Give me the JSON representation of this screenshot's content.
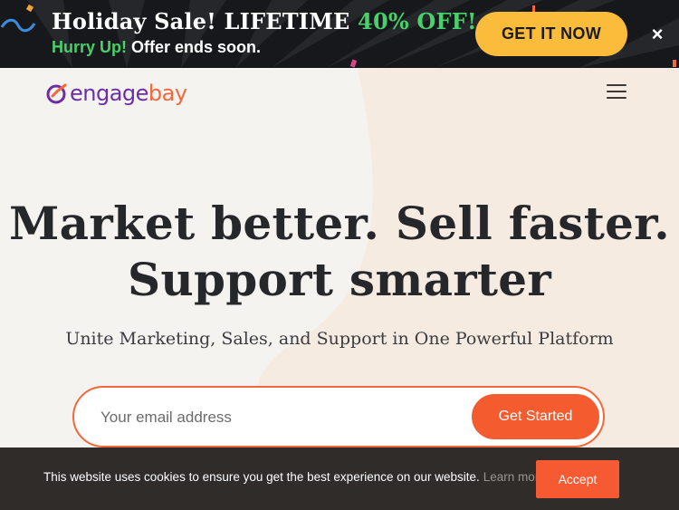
{
  "promo": {
    "title_prefix": "Holiday Sale! LIFETIME ",
    "title_highlight": "40% OFF!",
    "sub_highlight": "Hurry Up!",
    "sub_rest": " Offer ends soon.",
    "cta_label": "GET IT NOW",
    "close_label": "×"
  },
  "header": {
    "logo_part1": "engage",
    "logo_part2": "bay"
  },
  "hero": {
    "headline_line1": "Market better. Sell faster.",
    "headline_line2": "Support smarter",
    "subheadline": "Unite Marketing, Sales, and Support in One Powerful Platform"
  },
  "signup": {
    "email_placeholder": "Your email address",
    "button_label": "Get Started"
  },
  "cookie": {
    "message": "This website uses cookies to ensure you get the best experience on our website.",
    "learn_more": "Learn more",
    "accept_label": "Accept"
  },
  "colors": {
    "brand_purple": "#6b2ea8",
    "brand_orange": "#f2683a",
    "promo_green": "#48d06a",
    "cta_yellow": "#fbbb3b"
  }
}
